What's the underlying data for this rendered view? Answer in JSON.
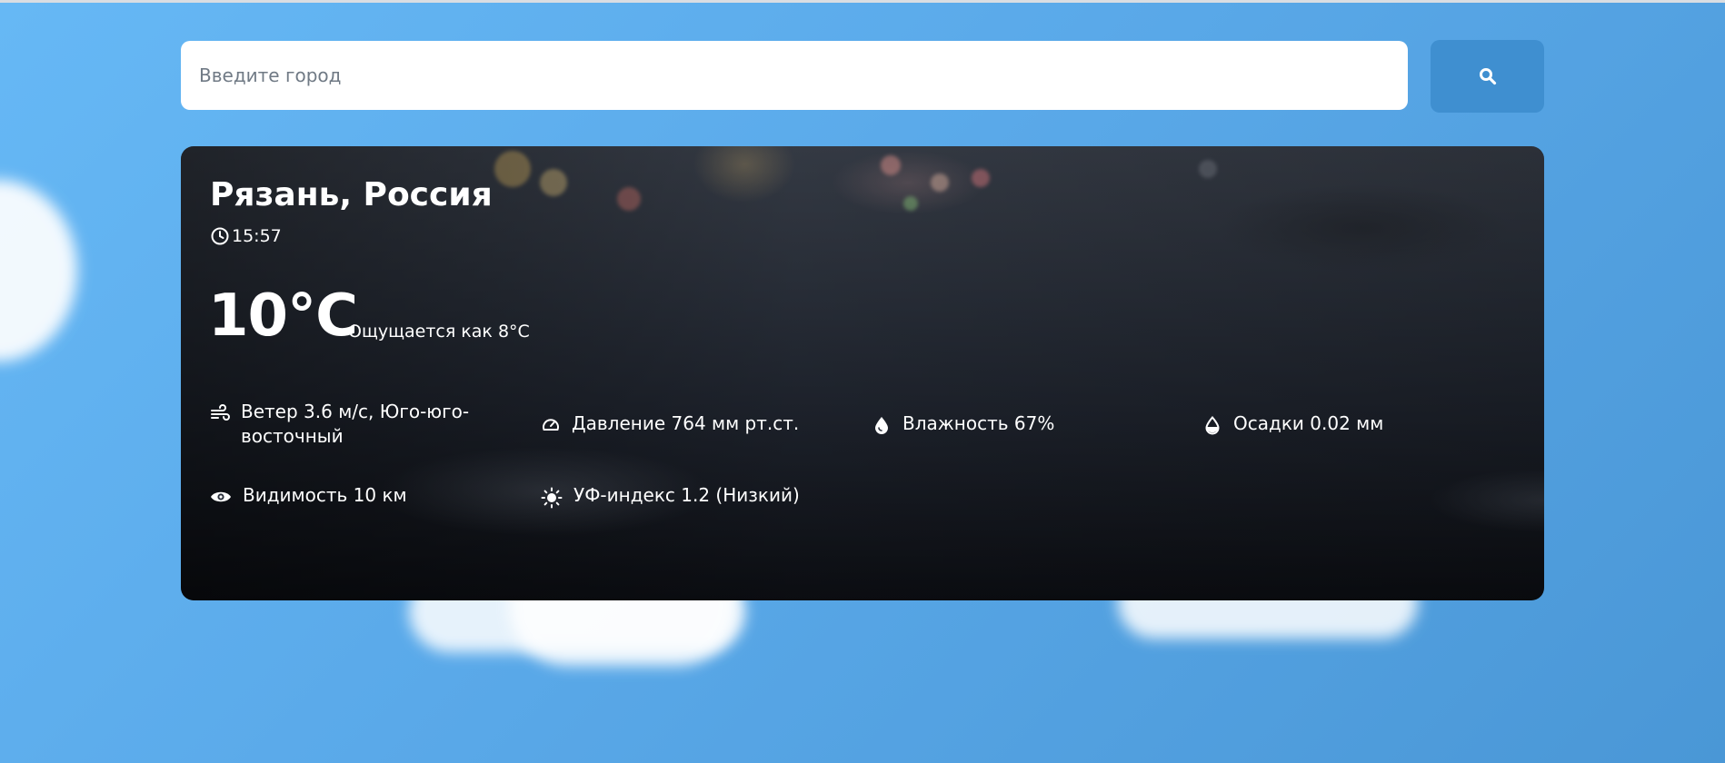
{
  "search": {
    "placeholder": "Введите город",
    "button_icon": "search-icon"
  },
  "weather": {
    "location": "Рязань, Россия",
    "time": "15:57",
    "temperature": "10°C",
    "feels_like": "Ощущается как 8°C",
    "background": "rainy-street-photo",
    "stats": {
      "wind": "Ветер 3.6 м/с, Юго-юго-восточный",
      "pressure": "Давление 764 мм рт.ст.",
      "humidity": "Влажность 67%",
      "precipitation": "Осадки 0.02 мм",
      "visibility": "Видимость 10 км",
      "uv": "УФ-индекс 1.2 (Низкий)"
    }
  },
  "colors": {
    "sky_gradient_start": "#66b8f5",
    "sky_gradient_end": "#4a97d6",
    "search_button": "#3f8fd0",
    "text_on_card": "#ffffff"
  }
}
